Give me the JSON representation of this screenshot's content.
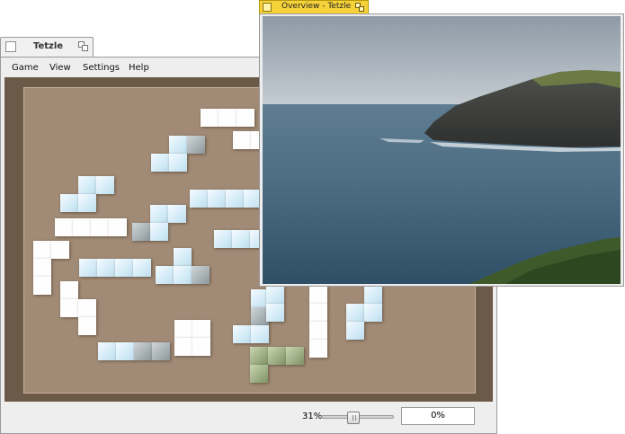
{
  "main_window": {
    "title": "Tetzle",
    "menu": [
      "Game",
      "View",
      "Settings",
      "Help"
    ]
  },
  "overview_window": {
    "title": "Overview - Tetzle"
  },
  "statusbar": {
    "zoom_label": "31%",
    "zoom_value_percent": 31,
    "progress_label": "0%"
  },
  "icons": {
    "window": "window-icon",
    "restore": "restore-icon",
    "slider": "slider-handle-icon"
  },
  "colors": {
    "workspace": "#6c5a48",
    "board": "#a18b76",
    "overview_tab": "#f5d23a"
  }
}
